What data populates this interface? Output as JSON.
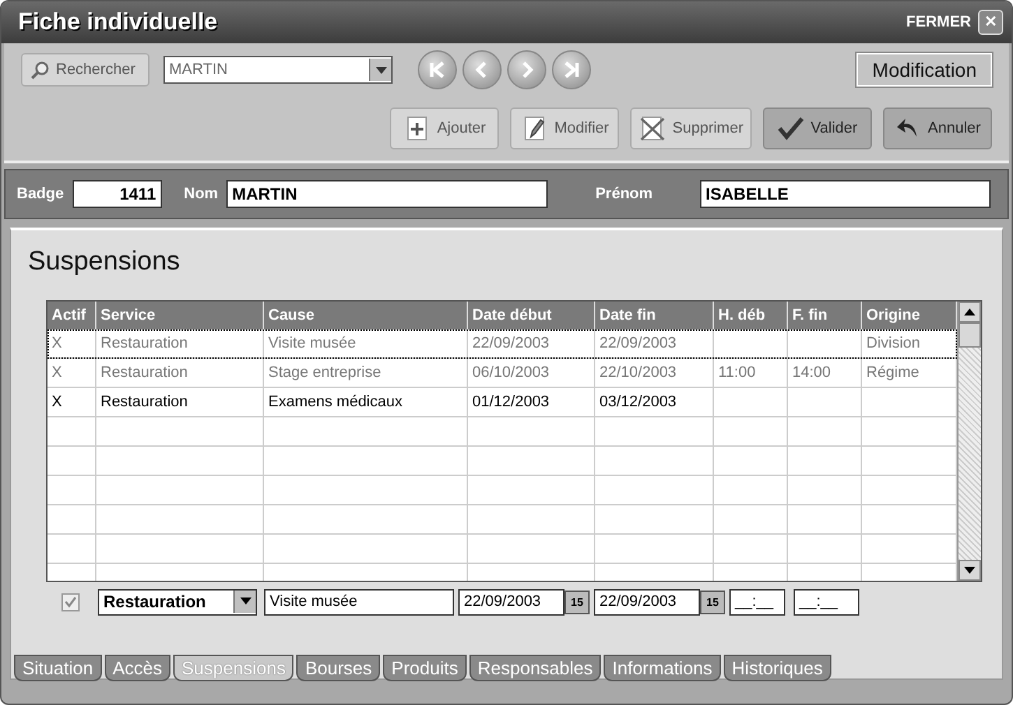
{
  "window": {
    "title": "Fiche individuelle",
    "close_label": "FERMER",
    "close_glyph": "✕"
  },
  "toolbar": {
    "search_button": {
      "label": "Rechercher",
      "disabled": true
    },
    "search_value": "MARTIN",
    "mode": "Modification",
    "actions": [
      {
        "label": "Ajouter",
        "kind": "add",
        "disabled": true
      },
      {
        "label": "Modifier",
        "kind": "edit",
        "disabled": true
      },
      {
        "label": "Supprimer",
        "kind": "delete",
        "disabled": true
      },
      {
        "label": "Valider",
        "kind": "ok",
        "disabled": false
      },
      {
        "label": "Annuler",
        "kind": "cancel",
        "disabled": false
      }
    ]
  },
  "identity": {
    "badge_label": "Badge",
    "badge": "1411",
    "nom_label": "Nom",
    "nom": "MARTIN",
    "prenom_label": "Prénom",
    "prenom": "ISABELLE"
  },
  "section_title": "Suspensions",
  "table": {
    "columns": [
      "Actif",
      "Service",
      "Cause",
      "Date début",
      "Date fin",
      "H. déb",
      "F. fin",
      "Origine"
    ],
    "rows": [
      {
        "cells": [
          "X",
          "Restauration",
          "Visite musée",
          "22/09/2003",
          "22/09/2003",
          "",
          "",
          "Division"
        ],
        "greyed": true,
        "selected": true
      },
      {
        "cells": [
          "X",
          "Restauration",
          "Stage entreprise",
          "06/10/2003",
          "22/10/2003",
          "11:00",
          "14:00",
          "Régime"
        ],
        "greyed": true,
        "selected": false
      },
      {
        "cells": [
          "X",
          "Restauration",
          "Examens médicaux",
          "01/12/2003",
          "03/12/2003",
          "",
          "",
          ""
        ],
        "greyed": false,
        "selected": false
      }
    ]
  },
  "editor": {
    "checked": true,
    "service": "Restauration",
    "cause": "Visite musée",
    "date_start": "22/09/2003",
    "date_end": "22/09/2003",
    "start_calendar_label": "15",
    "end_calendar_label": "15",
    "time_start": "__:__",
    "time_end": "__:__"
  },
  "tabs": [
    {
      "label": "Situation",
      "selected": false
    },
    {
      "label": "Accès",
      "selected": false
    },
    {
      "label": "Suspensions",
      "selected": true
    },
    {
      "label": "Bourses",
      "selected": false
    },
    {
      "label": "Produits",
      "selected": false
    },
    {
      "label": "Responsables",
      "selected": false
    },
    {
      "label": "Informations",
      "selected": false
    },
    {
      "label": "Historiques",
      "selected": false
    }
  ]
}
